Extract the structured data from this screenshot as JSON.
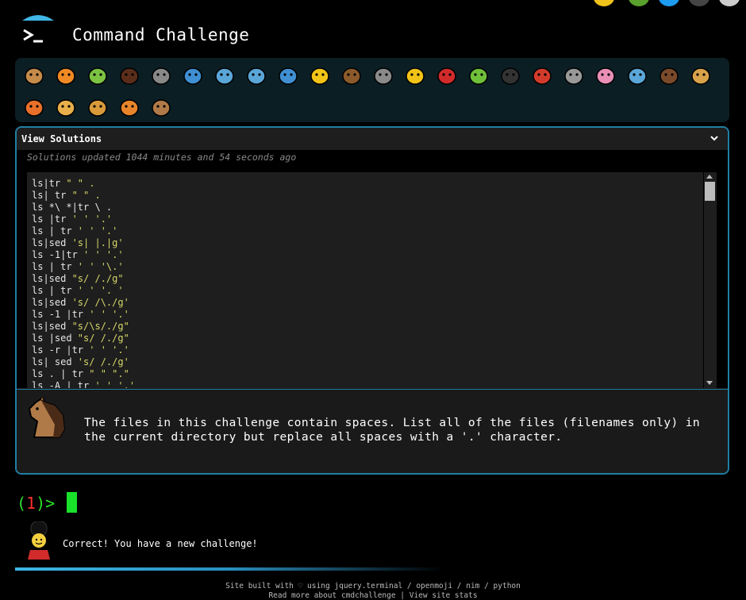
{
  "app": {
    "title": "Command Challenge"
  },
  "animals": [
    "snail",
    "butterfly",
    "caterpillar",
    "ant",
    "spider-web",
    "whale",
    "dolphin",
    "dolphin",
    "fish",
    "tropical-fish",
    "hedgehog",
    "wolf",
    "bee",
    "ladybug",
    "cricket",
    "spider",
    "scorpion",
    "mosquito",
    "worm",
    "microbe",
    "monkey",
    "dog",
    "fox",
    "cat",
    "lion",
    "tiger",
    "horse"
  ],
  "solutions": {
    "header": "View Solutions",
    "updated": "Solutions updated 1044 minutes and 54 seconds ago",
    "lines": [
      {
        "cmd": "ls|tr ",
        "arg": "\" \" ."
      },
      {
        "cmd": "ls| tr ",
        "arg": "\" \" ."
      },
      {
        "cmd": "ls *\\ *|tr \\ .",
        "arg": ""
      },
      {
        "cmd": "ls |tr ",
        "arg": "' ' '.'"
      },
      {
        "cmd": "ls | tr ",
        "arg": "' ' '.'"
      },
      {
        "cmd": "ls|sed ",
        "arg": "'s| |.|g'"
      },
      {
        "cmd": "ls -1|tr ",
        "arg": "' ' '.'"
      },
      {
        "cmd": "ls | tr ",
        "arg": "' ' '\\.'"
      },
      {
        "cmd": "ls|sed ",
        "arg": "\"s/ /./g\""
      },
      {
        "cmd": "ls | tr ",
        "arg": "' ' '. '"
      },
      {
        "cmd": "ls|sed ",
        "arg": "'s/ /\\./g'"
      },
      {
        "cmd": "ls -1 |tr ",
        "arg": "' ' '.'"
      },
      {
        "cmd": "ls|sed ",
        "arg": "\"s/\\s/./g\""
      },
      {
        "cmd": "ls |sed ",
        "arg": "\"s/ /./g\""
      },
      {
        "cmd": "ls -r |tr ",
        "arg": "' ' '.'"
      },
      {
        "cmd": "ls| sed ",
        "arg": "'s/ /./g'"
      },
      {
        "cmd": "ls . | tr ",
        "arg": "\" \" \".\""
      },
      {
        "cmd": "ls -A | tr ",
        "arg": "' ' '.'"
      }
    ]
  },
  "challenge": {
    "text": "The files in this challenge contain spaces. List all of the files (filenames only) in the current directory but replace all spaces with a '.' character."
  },
  "terminal": {
    "open_paren": "(",
    "count": "1",
    "close": ")>"
  },
  "message": "Correct! You have a new challenge!",
  "footer": {
    "line1": "Site built with ♡ using jquery.terminal / openmoji / nim / python",
    "line2": "Read more about cmdchallenge | View site stats"
  },
  "colors": {
    "accent": "#1f7fa3",
    "prompt_green": "#19e02b",
    "prompt_red": "#ff2d2d",
    "string_yellow": "#d7d76a"
  }
}
